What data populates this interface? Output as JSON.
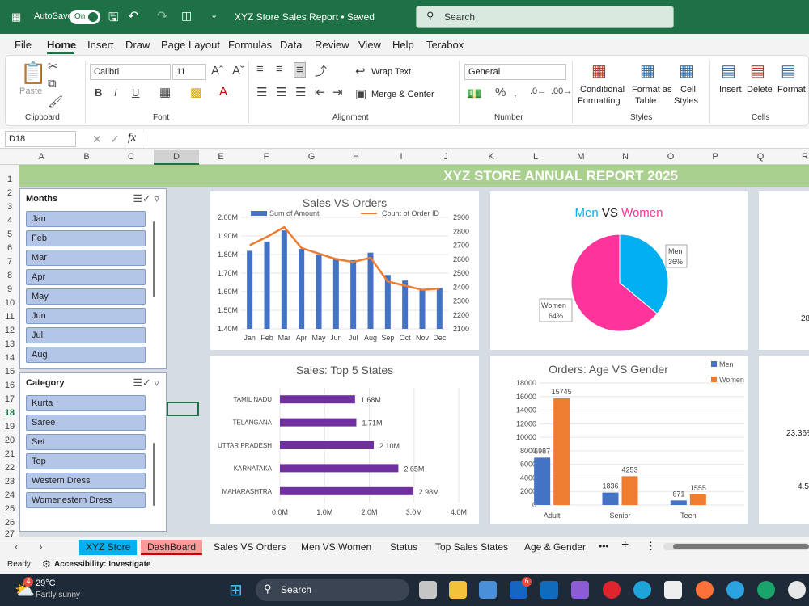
{
  "titlebar": {
    "autosave": "AutoSave",
    "toggle": "On",
    "filename": "XYZ Store Sales Report • Saved",
    "search": "Search"
  },
  "menu": [
    "File",
    "Home",
    "Insert",
    "Draw",
    "Page Layout",
    "Formulas",
    "Data",
    "Review",
    "View",
    "Help",
    "Terabox"
  ],
  "ribbon": {
    "paste": "Paste",
    "clipboard": "Clipboard",
    "font_name": "Calibri",
    "font_size": "11",
    "font": "Font",
    "wrap": "Wrap Text",
    "merge": "Merge & Center",
    "alignment": "Alignment",
    "number_format": "General",
    "number": "Number",
    "conditional": "Conditional",
    "formatting": "Formatting",
    "format_as": "Format as",
    "table": "Table",
    "cell": "Cell",
    "styles_btn": "Styles",
    "styles": "Styles",
    "insert": "Insert",
    "delete": "Delete",
    "format": "Format",
    "cells": "Cells"
  },
  "namebox": "D18",
  "fx": "fx",
  "columns": [
    "A",
    "B",
    "C",
    "D",
    "E",
    "F",
    "G",
    "H",
    "I",
    "J",
    "K",
    "L",
    "M",
    "N",
    "O",
    "P",
    "Q",
    "R"
  ],
  "rows": [
    "1",
    "2",
    "3",
    "4",
    "5",
    "6",
    "7",
    "8",
    "9",
    "10",
    "11",
    "12",
    "13",
    "14",
    "15",
    "16",
    "17",
    "18",
    "19",
    "20",
    "21",
    "22",
    "23",
    "24",
    "25",
    "26",
    "27"
  ],
  "banner": "XYZ STORE ANNUAL REPORT 2025",
  "slicer_months": {
    "title": "Months",
    "items": [
      "Jan",
      "Feb",
      "Mar",
      "Apr",
      "May",
      "Jun",
      "Jul",
      "Aug"
    ]
  },
  "slicer_category": {
    "title": "Category",
    "items": [
      "Kurta",
      "Saree",
      "Set",
      "Top",
      "Western Dress",
      "Womenestern Dress"
    ]
  },
  "chart_data": [
    {
      "type": "bar",
      "title": "Sales VS Orders",
      "categories": [
        "Jan",
        "Feb",
        "Mar",
        "Apr",
        "May",
        "Jun",
        "Jul",
        "Aug",
        "Sep",
        "Oct",
        "Nov",
        "Dec"
      ],
      "series": [
        {
          "name": "Sum of Amount",
          "kind": "bar",
          "axis": "left",
          "values": [
            1.82,
            1.87,
            1.93,
            1.83,
            1.8,
            1.78,
            1.77,
            1.81,
            1.69,
            1.66,
            1.61,
            1.62
          ]
        },
        {
          "name": "Count of Order ID",
          "kind": "line",
          "axis": "right",
          "values": [
            2700,
            2760,
            2830,
            2680,
            2640,
            2600,
            2580,
            2610,
            2440,
            2410,
            2380,
            2390
          ]
        }
      ],
      "yticks_left": [
        "2.00M",
        "1.90M",
        "1.80M",
        "1.70M",
        "1.60M",
        "1.50M",
        "1.40M"
      ],
      "yticks_right": [
        "2900",
        "2800",
        "2700",
        "2600",
        "2500",
        "2400",
        "2300",
        "2200",
        "2100"
      ],
      "ylim_left": [
        1.4,
        2.0
      ],
      "ylim_right": [
        2100,
        2900
      ]
    },
    {
      "type": "pie",
      "title_parts": [
        "Men",
        " VS ",
        "Women"
      ],
      "slices": [
        {
          "name": "Men",
          "pct": "36%",
          "value": 36,
          "color": "#00b0f0"
        },
        {
          "name": "Women",
          "pct": "64%",
          "value": 64,
          "color": "#ff3399"
        }
      ]
    },
    {
      "type": "bar",
      "orientation": "horizontal",
      "title": "Sales: Top 5 States",
      "categories": [
        "TAMIL NADU",
        "TELANGANA",
        "UTTAR PRADESH",
        "KARNATAKA",
        "MAHARASHTRA"
      ],
      "values": [
        1.68,
        1.71,
        2.1,
        2.65,
        2.98
      ],
      "labels": [
        "1.68M",
        "1.71M",
        "2.10M",
        "2.65M",
        "2.98M"
      ],
      "xticks": [
        "0.0M",
        "1.0M",
        "2.0M",
        "3.0M",
        "4.0M"
      ],
      "xlim": [
        0,
        4
      ]
    },
    {
      "type": "bar",
      "title": "Orders: Age VS Gender",
      "categories": [
        "Adult",
        "Senior",
        "Teen"
      ],
      "series": [
        {
          "name": "Men",
          "values": [
            6987,
            1836,
            671
          ],
          "color": "#4472c4"
        },
        {
          "name": "Women",
          "values": [
            15745,
            4253,
            1555
          ],
          "color": "#ed7d31"
        }
      ],
      "yticks": [
        "18000",
        "16000",
        "14000",
        "12000",
        "10000",
        "8000",
        "6000",
        "4000",
        "2000",
        "0"
      ],
      "ylim": [
        0,
        18000
      ]
    }
  ],
  "partial_right": [
    "28",
    "23.36%",
    "4.5"
  ],
  "sheet_tabs": [
    "XYZ Store",
    "DashBoard",
    "Sales VS Orders",
    "Men VS Women",
    "Status",
    "Top Sales States",
    "Age & Gender"
  ],
  "status": {
    "ready": "Ready",
    "accessibility": "Accessibility: Investigate"
  },
  "taskbar": {
    "temp": "29°C",
    "weather": "Partly sunny",
    "search": "Search",
    "badge1": "4",
    "badge2": "6"
  }
}
